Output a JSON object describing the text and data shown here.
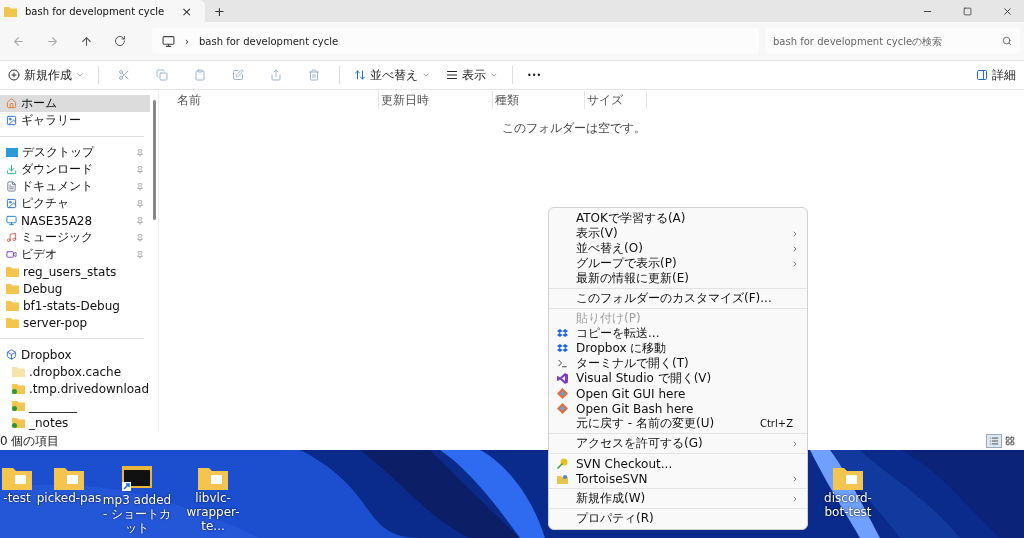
{
  "window": {
    "tab_title": "bash for development cycle",
    "tab_close": "×",
    "new_tab": "+"
  },
  "address": {
    "path": "bash for development cycle",
    "separator": "›",
    "search_placeholder": "bash for development cycleの検索"
  },
  "toolbar": {
    "new": "新規作成",
    "sort": "並べ替え",
    "view": "表示",
    "more": "•••",
    "details": "詳細"
  },
  "sidebar": {
    "sections": [
      [
        {
          "label": "ホーム",
          "kind": "home",
          "selected": true,
          "pinned": false
        },
        {
          "label": "ギャラリー",
          "kind": "gallery",
          "selected": false,
          "pinned": false
        }
      ],
      [
        {
          "label": "デスクトップ",
          "kind": "desktop",
          "selected": false,
          "pinned": true
        },
        {
          "label": "ダウンロード",
          "kind": "download",
          "selected": false,
          "pinned": true
        },
        {
          "label": "ドキュメント",
          "kind": "document",
          "selected": false,
          "pinned": true
        },
        {
          "label": "ピクチャ",
          "kind": "pictures",
          "selected": false,
          "pinned": true
        },
        {
          "label": "NASE35A28",
          "kind": "monitor",
          "selected": false,
          "pinned": true
        },
        {
          "label": "ミュージック",
          "kind": "music",
          "selected": false,
          "pinned": true
        },
        {
          "label": "ビデオ",
          "kind": "video",
          "selected": false,
          "pinned": true
        },
        {
          "label": "reg_users_stats",
          "kind": "folder",
          "selected": false,
          "pinned": false
        },
        {
          "label": "Debug",
          "kind": "folder",
          "selected": false,
          "pinned": false
        },
        {
          "label": "bf1-stats-Debug",
          "kind": "folder",
          "selected": false,
          "pinned": false
        },
        {
          "label": "server-pop",
          "kind": "folder",
          "selected": false,
          "pinned": false
        }
      ],
      [
        {
          "label": "Dropbox",
          "kind": "dropbox",
          "selected": false,
          "pinned": false,
          "children": [
            {
              "label": ".dropbox.cache",
              "kind": "folder-light",
              "selected": false,
              "pinned": false
            },
            {
              "label": ".tmp.drivedownload",
              "kind": "folder-synced",
              "selected": false,
              "pinned": false
            },
            {
              "label": "________",
              "kind": "folder-synced",
              "selected": false,
              "pinned": false
            },
            {
              "label": "_notes",
              "kind": "folder-synced",
              "selected": false,
              "pinned": false
            }
          ]
        }
      ]
    ]
  },
  "columns": [
    "名前",
    "更新日時",
    "種類",
    "サイズ"
  ],
  "empty_message": "このフォルダーは空です。",
  "status_bar": {
    "count": "0 個の項目"
  },
  "context_menu": [
    [
      {
        "label": "ATOKで学習する(A)",
        "kind": "plain",
        "submenu": false,
        "disabled": false
      },
      {
        "label": "表示(V)",
        "kind": "plain",
        "submenu": true,
        "disabled": false
      },
      {
        "label": "並べ替え(O)",
        "kind": "plain",
        "submenu": true,
        "disabled": false
      },
      {
        "label": "グループで表示(P)",
        "kind": "plain",
        "submenu": true,
        "disabled": false
      },
      {
        "label": "最新の情報に更新(E)",
        "kind": "plain",
        "submenu": false,
        "disabled": false
      }
    ],
    [
      {
        "label": "このフォルダーのカスタマイズ(F)...",
        "kind": "plain",
        "submenu": false,
        "disabled": false
      }
    ],
    [
      {
        "label": "貼り付け(P)",
        "kind": "plain",
        "submenu": false,
        "disabled": true
      },
      {
        "label": "コピーを転送...",
        "kind": "dropbox",
        "submenu": false,
        "disabled": false
      },
      {
        "label": "Dropbox に移動",
        "kind": "dropbox",
        "submenu": false,
        "disabled": false
      },
      {
        "label": "ターミナルで開く(T)",
        "kind": "terminal",
        "submenu": false,
        "disabled": false
      },
      {
        "label": "Visual Studio で開く(V)",
        "kind": "vs",
        "submenu": false,
        "disabled": false
      },
      {
        "label": "Open Git GUI here",
        "kind": "git",
        "submenu": false,
        "disabled": false
      },
      {
        "label": "Open Git Bash here",
        "kind": "git",
        "submenu": false,
        "disabled": false
      },
      {
        "label": "元に戻す - 名前の変更(U)",
        "kind": "plain",
        "submenu": false,
        "disabled": false,
        "shortcut": "Ctrl+Z"
      }
    ],
    [
      {
        "label": "アクセスを許可する(G)",
        "kind": "plain",
        "submenu": true,
        "disabled": false
      }
    ],
    [
      {
        "label": "SVN Checkout...",
        "kind": "svn",
        "submenu": false,
        "disabled": false
      },
      {
        "label": "TortoiseSVN",
        "kind": "tortoise",
        "submenu": true,
        "disabled": false
      }
    ],
    [
      {
        "label": "新規作成(W)",
        "kind": "plain",
        "submenu": true,
        "disabled": false
      }
    ],
    [
      {
        "label": "プロパティ(R)",
        "kind": "plain",
        "submenu": false,
        "disabled": false
      }
    ]
  ],
  "desktop_icons": [
    {
      "label": "-test",
      "kind": "folder"
    },
    {
      "label": "picked-pas",
      "kind": "folder"
    },
    {
      "label": "mp3 added - ショートカット",
      "kind": "shortcut"
    },
    {
      "label": "libvlc-wrapper-te...",
      "kind": "folder"
    },
    {
      "label": "discord-bot-test",
      "kind": "folder"
    }
  ]
}
